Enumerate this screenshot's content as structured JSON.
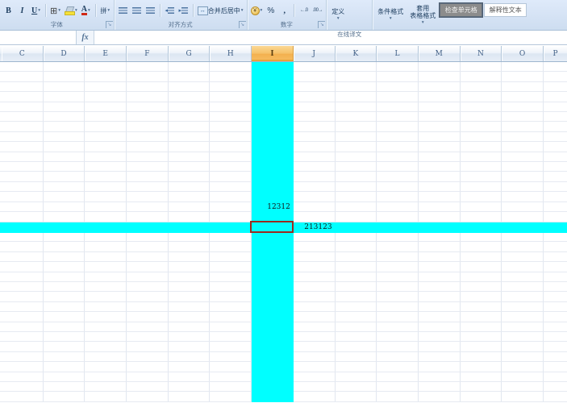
{
  "ribbon": {
    "font": {
      "label": "字体",
      "bold": "B",
      "italic": "I",
      "underline": "U",
      "phonetic": "拼"
    },
    "alignment": {
      "label": "对齐方式",
      "merge_center": "合并后居中"
    },
    "number": {
      "label": "数字",
      "currency": "¥",
      "percent": "%",
      "comma": ",",
      "inc_decimal": "←.0",
      "dec_decimal": ".00→"
    },
    "translate": {
      "label": "在线译文",
      "define_button": "定义"
    },
    "styles": {
      "conditional_formatting": "条件格式",
      "format_as_table_line1": "套用",
      "format_as_table_line2": "表格格式",
      "cell_style_check": "检查单元格",
      "cell_style_explanatory": "解释性文本"
    }
  },
  "formula_bar": {
    "fx": "fx",
    "name_box_value": "",
    "formula_value": ""
  },
  "grid": {
    "columns": [
      "C",
      "D",
      "E",
      "F",
      "G",
      "H",
      "I",
      "J",
      "K",
      "L",
      "M",
      "N",
      "O",
      "P"
    ],
    "row_count": 34,
    "selected_column": "I",
    "selected_row_index": 16,
    "cells": [
      {
        "column": "I",
        "row_index": 14,
        "value": "12312"
      },
      {
        "column": "J",
        "row_index": 16,
        "value": "213123"
      }
    ],
    "colors": {
      "highlight_fill": "#00FFFF",
      "selection_border": "#9B2B1F",
      "selected_header_fill": "#F6C067"
    }
  }
}
